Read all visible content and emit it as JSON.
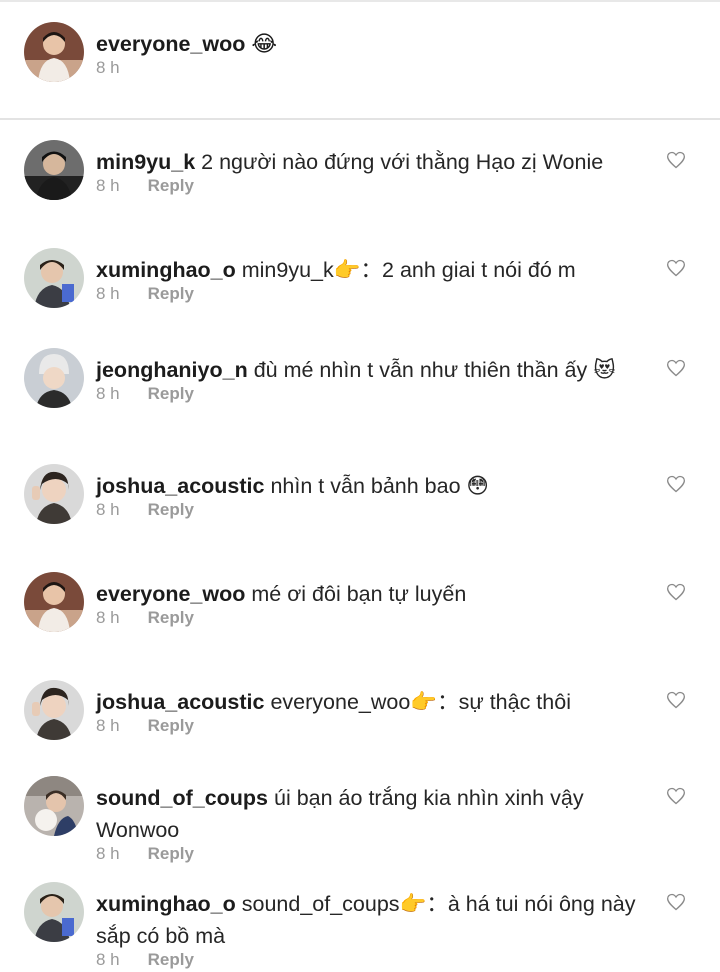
{
  "post": {
    "username": "everyone_woo",
    "caption_emoji": "😂",
    "time": "8 h"
  },
  "reply_label": "Reply",
  "comments": [
    {
      "username": "min9yu_k",
      "text": "2 người nào đứng với thằng Hạo zị Wonie",
      "time": "8 h",
      "avatar": "avatar-min9yu"
    },
    {
      "username": "xuminghao_o",
      "text": "min9yu_k👉：2 anh giai t nói đó m",
      "time": "8 h",
      "avatar": "avatar-xuminghao"
    },
    {
      "username": "jeonghaniyo_n",
      "text": "đù mé nhìn t vẫn như thiên thần ấy 😻",
      "time": "8 h",
      "avatar": "avatar-jeonghan"
    },
    {
      "username": "joshua_acoustic",
      "text": "nhìn t vẫn bảnh bao 😳",
      "time": "8 h",
      "avatar": "avatar-joshua"
    },
    {
      "username": "everyone_woo",
      "text": "mé ơi đôi bạn tự luyến",
      "time": "8 h",
      "avatar": "avatar-everyone"
    },
    {
      "username": "joshua_acoustic",
      "text": "everyone_woo👉：sự thậc thôi",
      "time": "8 h",
      "avatar": "avatar-joshua"
    },
    {
      "username": "sound_of_coups",
      "text": "úi bạn áo trắng kia nhìn xinh vậy Wonwoo",
      "time": "8 h",
      "avatar": "avatar-coups"
    },
    {
      "username": "xuminghao_o",
      "text": "sound_of_coups👉：à há tui nói ông này sắp có bồ mà",
      "time": "8 h",
      "avatar": "avatar-xuminghao"
    }
  ]
}
